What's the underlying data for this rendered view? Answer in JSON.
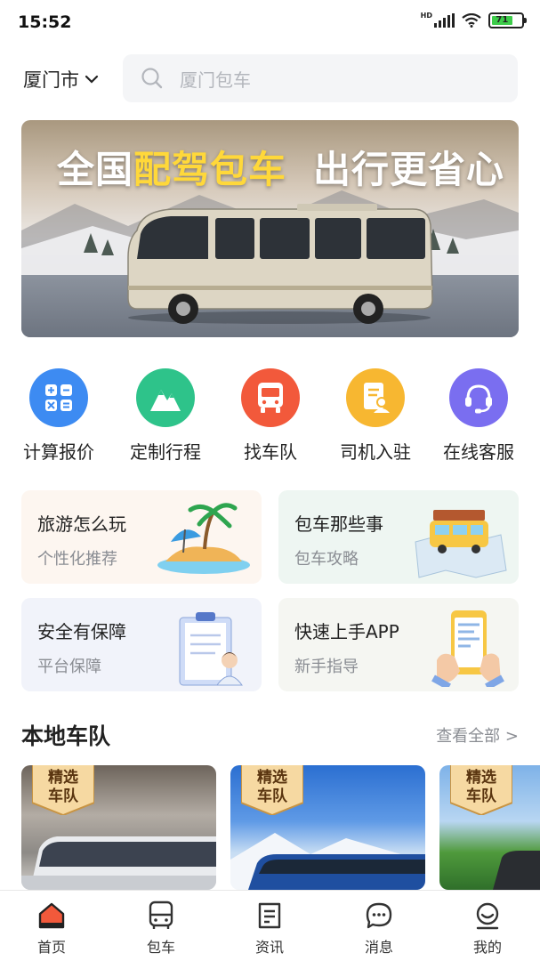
{
  "status_bar": {
    "time": "15:52",
    "network": "HD",
    "battery": "71"
  },
  "header": {
    "city": "厦门市",
    "search_placeholder": "厦门包车"
  },
  "banner": {
    "title_part1": "全国",
    "title_highlight": "配驾包车",
    "title_part2": "出行更省心"
  },
  "quick_actions": [
    {
      "label": "计算报价",
      "icon": "calculator-icon",
      "color": "#3d8bf2"
    },
    {
      "label": "定制行程",
      "icon": "mountain-icon",
      "color": "#2ec38a"
    },
    {
      "label": "找车队",
      "icon": "bus-icon",
      "color": "#f2593b"
    },
    {
      "label": "司机入驻",
      "icon": "driver-doc-icon",
      "color": "#f7b731"
    },
    {
      "label": "在线客服",
      "icon": "headset-icon",
      "color": "#7a6ef0"
    }
  ],
  "cards": [
    {
      "title": "旅游怎么玩",
      "subtitle": "个性化推荐",
      "bg": "#fdf6f0"
    },
    {
      "title": "包车那些事",
      "subtitle": "包车攻略",
      "bg": "#eef6f2"
    },
    {
      "title": "安全有保障",
      "subtitle": "平台保障",
      "bg": "#f1f3fa"
    },
    {
      "title": "快速上手APP",
      "subtitle": "新手指导",
      "bg": "#f5f6f2"
    }
  ],
  "local_fleet": {
    "title": "本地车队",
    "more": "查看全部 >",
    "badge_line1": "精选",
    "badge_line2": "车队"
  },
  "tabbar": [
    {
      "label": "首页",
      "active": true
    },
    {
      "label": "包车",
      "active": false
    },
    {
      "label": "资讯",
      "active": false
    },
    {
      "label": "消息",
      "active": false
    },
    {
      "label": "我的",
      "active": false
    }
  ],
  "colors": {
    "accent": "#f2593b",
    "brand_yellow": "#ffd83a"
  }
}
